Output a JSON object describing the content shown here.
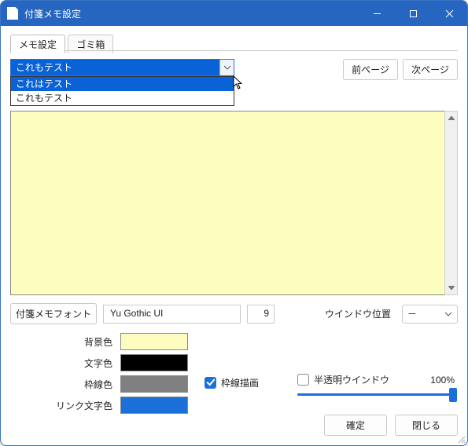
{
  "window": {
    "title": "付箋メモ設定"
  },
  "tabs": {
    "memo": "メモ設定",
    "trash": "ゴミ箱"
  },
  "pager": {
    "prev": "前ページ",
    "next": "次ページ"
  },
  "memo_select": {
    "selected": "これもテスト",
    "options": [
      "これはテスト",
      "これもテスト"
    ]
  },
  "font": {
    "button": "付箋メモフォント",
    "name": "Yu Gothic UI",
    "size": "9"
  },
  "window_pos": {
    "label": "ウインドウ位置",
    "value": "－"
  },
  "colors": {
    "bg": {
      "label": "背景色",
      "value": "#fdfdc0"
    },
    "text": {
      "label": "文字色",
      "value": "#000000"
    },
    "frame": {
      "label": "枠線色",
      "value": "#808080"
    },
    "link": {
      "label": "リンク文字色",
      "value": "#1a6fd8"
    }
  },
  "checks": {
    "draw_frame": {
      "label": "枠線描画",
      "checked": true
    },
    "translucent": {
      "label": "半透明ウインドウ",
      "checked": false,
      "percent": "100%"
    }
  },
  "footer": {
    "ok": "確定",
    "close": "閉じる"
  }
}
